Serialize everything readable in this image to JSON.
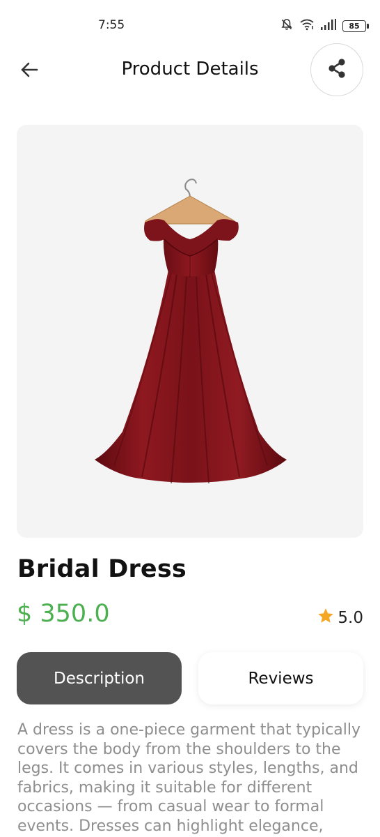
{
  "status_bar": {
    "time": "7:55",
    "battery": "85",
    "icons": [
      "mute-bell-icon",
      "wifi-icon",
      "signal-icon",
      "battery-icon"
    ]
  },
  "app_bar": {
    "title": "Product Details",
    "back_icon": "arrow-left-icon",
    "share_icon": "share-icon"
  },
  "product": {
    "image_alt": "dress-on-hanger",
    "name": "Bridal Dress",
    "price": "$ 350.0",
    "rating": "5.0",
    "price_color": "#4caf50",
    "star_color": "#f5a623"
  },
  "tabs": [
    {
      "label": "Description",
      "active": true
    },
    {
      "label": "Reviews",
      "active": false
    }
  ],
  "description": {
    "text": "A dress is a one-piece garment that typically covers the body from the shoulders to the legs. It comes in various styles, lengths, and fabrics, making it suitable for different occasions — from casual wear to formal events. Dresses can highlight elegance, fabric and it easily suitable for different occasions"
  }
}
